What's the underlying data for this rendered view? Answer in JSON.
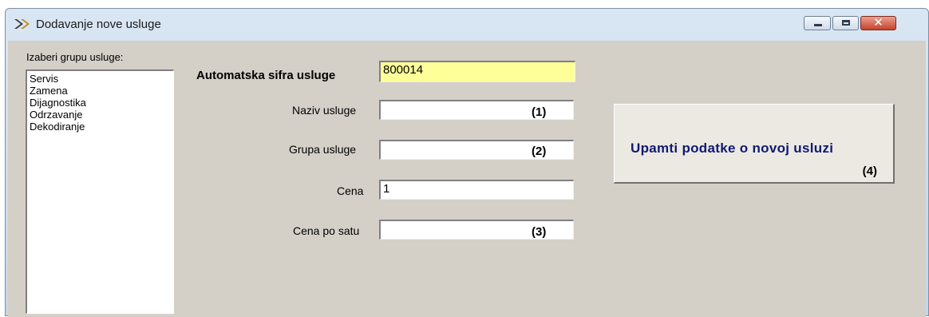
{
  "window": {
    "title": "Dodavanje nove usluge"
  },
  "group_list": {
    "label": "Izaberi grupu usluge:",
    "items": [
      "Servis",
      "Zamena",
      "Dijagnostika",
      "Odrzavanje",
      "Dekodiranje"
    ]
  },
  "form": {
    "code_label": "Automatska sifra usluge",
    "code_value": "800014",
    "name_label": "Naziv usluge",
    "name_value": "",
    "name_marker": "(1)",
    "group_label": "Grupa usluge",
    "group_value": "",
    "group_marker": "(2)",
    "price_label": "Cena",
    "price_value": "1",
    "hourly_label": "Cena po satu",
    "hourly_value": "",
    "hourly_marker": "(3)"
  },
  "save_button": {
    "label": "Upamti podatke o novoj usluzi",
    "marker": "(4)"
  },
  "colors": {
    "code_field_bg": "#ffff99",
    "button_text": "#0f1a73",
    "dialog_bg": "#d4d0c8"
  }
}
